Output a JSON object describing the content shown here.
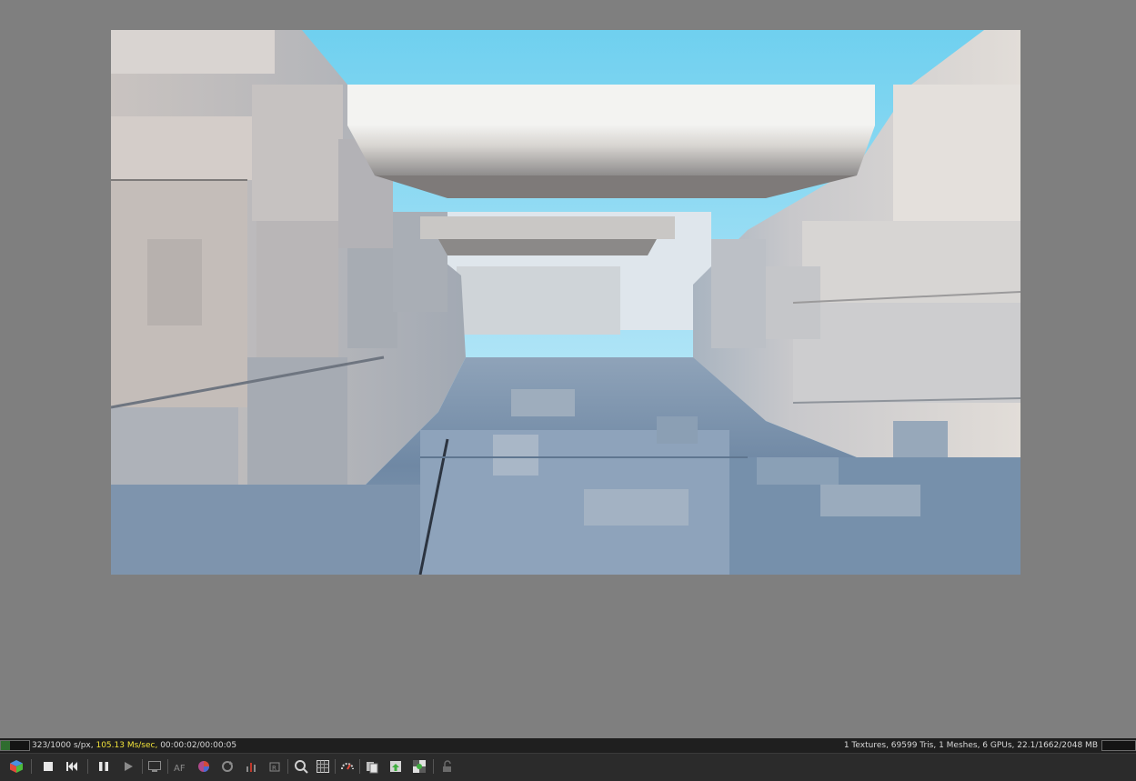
{
  "status": {
    "samples": "323/1000 s/px, ",
    "speed": "105.13 Ms/sec,",
    "time": " 00:00:02/00:00:05",
    "scene_stats": "1 Textures, 69599 Tris, 1 Meshes, 6 GPUs, 22.1/1662/2048 MB",
    "progress_fraction": 0.323,
    "highlight_color": "#f0e23a"
  },
  "toolbar": {
    "af_label": "AF",
    "items": [
      "cube-icon",
      "stop-icon",
      "restart-icon",
      "pause-icon",
      "play-icon",
      "display-icon",
      "af-icon",
      "color-wheel-icon",
      "refresh-icon",
      "levels-icon",
      "region-icon",
      "zoom-icon",
      "grid-icon",
      "gauge-icon",
      "copy-icon",
      "save-icon",
      "checker-icon",
      "lock-icon"
    ]
  }
}
